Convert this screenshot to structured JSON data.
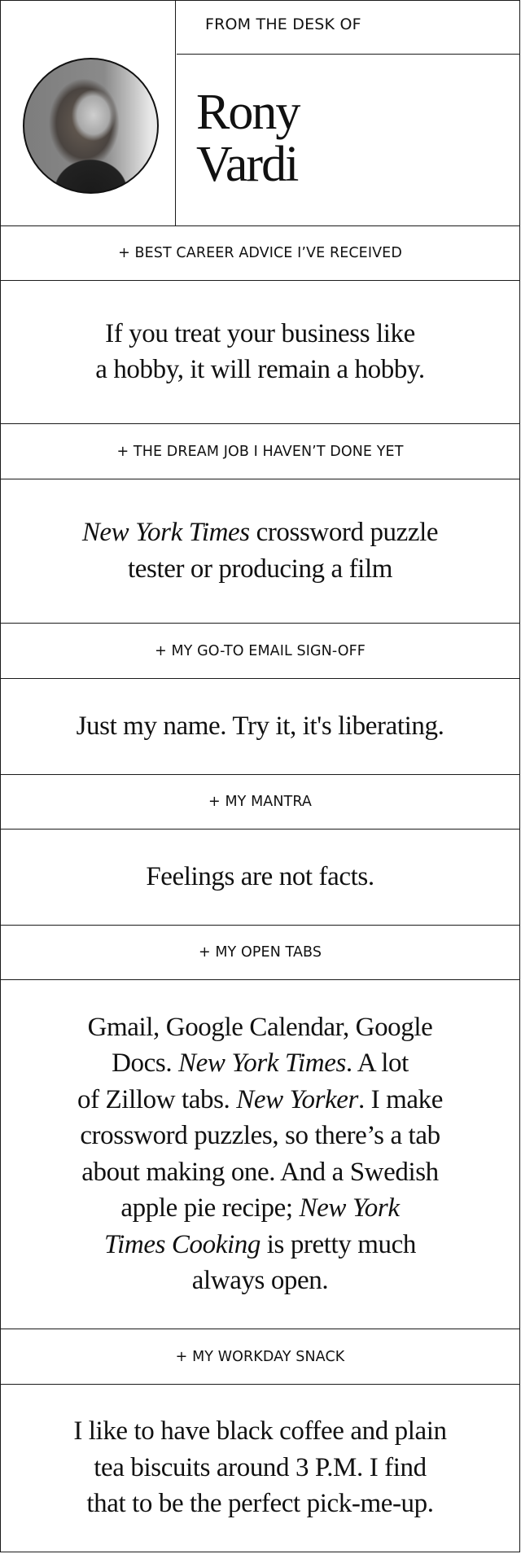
{
  "header": {
    "eyebrow": "FROM THE DESK OF",
    "first_name": "Rony",
    "last_name": "Vardi",
    "avatar_alt": "Portrait of Rony Vardi"
  },
  "sections": [
    {
      "label": "+ BEST CAREER ADVICE I’VE RECEIVED",
      "lines": [
        [
          {
            "text": "If you treat your business like",
            "italic": false
          }
        ],
        [
          {
            "text": "a hobby, it will remain a hobby.",
            "italic": false
          }
        ]
      ]
    },
    {
      "label": "+ THE DREAM JOB I HAVEN’T DONE YET",
      "lines": [
        [
          {
            "text": "New York Times",
            "italic": true
          },
          {
            "text": " crossword puzzle",
            "italic": false
          }
        ],
        [
          {
            "text": "tester or producing a film",
            "italic": false
          }
        ]
      ]
    },
    {
      "label": "+ MY GO-TO EMAIL SIGN-OFF",
      "lines": [
        [
          {
            "text": "Just my name. Try it, it's liberating.",
            "italic": false
          }
        ]
      ]
    },
    {
      "label": "+ MY MANTRA",
      "lines": [
        [
          {
            "text": "Feelings are not facts.",
            "italic": false
          }
        ]
      ]
    },
    {
      "label": "+ MY OPEN TABS",
      "lines": [
        [
          {
            "text": "Gmail, Google Calendar, Google",
            "italic": false
          }
        ],
        [
          {
            "text": "Docs. ",
            "italic": false
          },
          {
            "text": "New York Times",
            "italic": true
          },
          {
            "text": ". A lot",
            "italic": false
          }
        ],
        [
          {
            "text": "of Zillow tabs. ",
            "italic": false
          },
          {
            "text": "New Yorker",
            "italic": true
          },
          {
            "text": ". I make",
            "italic": false
          }
        ],
        [
          {
            "text": "crossword puzzles, so there’s a tab",
            "italic": false
          }
        ],
        [
          {
            "text": "about making one. And a Swedish",
            "italic": false
          }
        ],
        [
          {
            "text": "apple pie recipe; ",
            "italic": false
          },
          {
            "text": "New York",
            "italic": true
          }
        ],
        [
          {
            "text": "Times Cooking",
            "italic": true
          },
          {
            "text": " is pretty much",
            "italic": false
          }
        ],
        [
          {
            "text": "always open.",
            "italic": false
          }
        ]
      ]
    },
    {
      "label": "+ MY WORKDAY SNACK",
      "lines": [
        [
          {
            "text": "I like to have black coffee and plain",
            "italic": false
          }
        ],
        [
          {
            "text": "tea biscuits around 3 P.M. I find",
            "italic": false
          }
        ],
        [
          {
            "text": "that to be the perfect pick-me-up.",
            "italic": false
          }
        ]
      ]
    }
  ]
}
